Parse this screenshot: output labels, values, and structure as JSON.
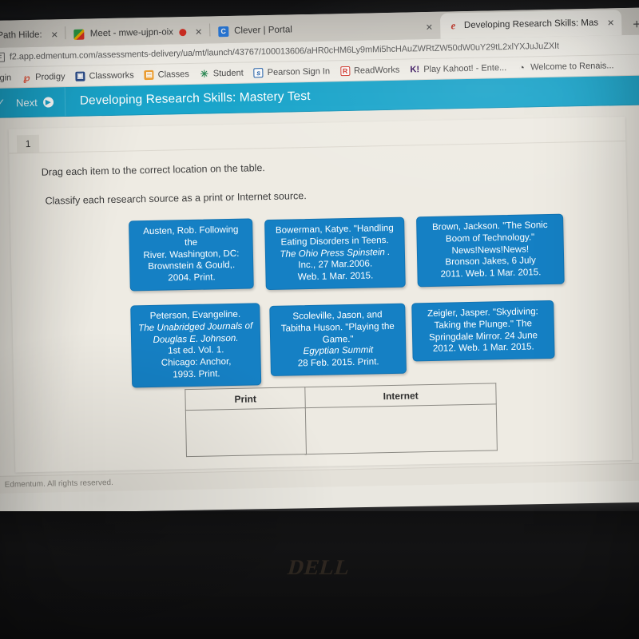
{
  "browser": {
    "tabs": [
      {
        "title": "Path Hilde:",
        "favicon": "none",
        "has_close": true,
        "active": false
      },
      {
        "title": "Meet - mwe-ujpn-oix",
        "favicon": "google-meet-icon",
        "has_close": true,
        "active": false,
        "recording": true
      },
      {
        "title": "Clever | Portal",
        "favicon": "clever-icon",
        "favicon_letter": "C",
        "has_close": true,
        "active": false
      },
      {
        "title": "Developing Research Skills: Mas",
        "favicon": "edge-icon",
        "has_close": true,
        "active": true
      }
    ],
    "new_tab_label": "+",
    "close_glyph": "✕",
    "url": "f2.app.edmentum.com/assessments-delivery/ua/mt/launch/43767/100013606/aHR0cHM6Ly9mMi5hcHAuZWRtZW50dW0uY29tL2xlYXJuJuZXIt",
    "bookmarks": [
      {
        "label": "ogin",
        "icon": "none"
      },
      {
        "label": "Prodigy",
        "icon": "prodigy-icon",
        "glyph": "℘"
      },
      {
        "label": "Classworks",
        "icon": "classworks-icon",
        "glyph": "▣"
      },
      {
        "label": "Classes",
        "icon": "classes-icon",
        "glyph": "▤"
      },
      {
        "label": "Student",
        "icon": "student-icon",
        "glyph": "✳"
      },
      {
        "label": "Pearson Sign In",
        "icon": "pearson-icon",
        "glyph": "s"
      },
      {
        "label": "ReadWorks",
        "icon": "readworks-icon",
        "glyph": "R"
      },
      {
        "label": "Play Kahoot! - Ente...",
        "icon": "kahoot-icon",
        "glyph": "K!"
      },
      {
        "label": "Welcome to Renais...",
        "icon": "renaissance-icon",
        "glyph": "◔"
      }
    ]
  },
  "app_header": {
    "check_glyph": "✓",
    "next_label": "Next",
    "next_arrow_glyph": "▶",
    "title": "Developing Research Skills: Mastery Test",
    "bg_color": "#1aa5cb"
  },
  "question": {
    "number": "1",
    "instruction_1": "Drag each item to the correct location on the table.",
    "instruction_2": "Classify each research source as a print or Internet source."
  },
  "cards": [
    {
      "id": "card-1",
      "name": "source-card-austen",
      "lines": [
        {
          "text": "Austen, Rob. Following the",
          "italic": false
        },
        {
          "text": "River. Washington, DC:",
          "italic": false
        },
        {
          "text": "Brownstein & Gould,.",
          "italic": false
        },
        {
          "text": "2004. Print.",
          "italic": false
        }
      ]
    },
    {
      "id": "card-2",
      "name": "source-card-bowerman",
      "lines": [
        {
          "text": "Bowerman, Katye. \"Handling",
          "italic": false
        },
        {
          "text": "Eating Disorders in Teens.",
          "italic": false
        },
        {
          "text": "The Ohio Press Spinstein .",
          "italic": true
        },
        {
          "text": "Inc., 27 Mar.2006.",
          "italic": false
        },
        {
          "text": "Web. 1 Mar. 2015.",
          "italic": false
        }
      ]
    },
    {
      "id": "card-3",
      "name": "source-card-brown",
      "lines": [
        {
          "text": "Brown, Jackson. \"The Sonic",
          "italic": false
        },
        {
          "text": "Boom of Technology.\"",
          "italic": false
        },
        {
          "text": "News!News!News!",
          "italic": false
        },
        {
          "text": "Bronson Jakes, 6 July",
          "italic": false
        },
        {
          "text": "2011. Web. 1 Mar. 2015.",
          "italic": false
        }
      ]
    },
    {
      "id": "card-4",
      "name": "source-card-peterson",
      "lines": [
        {
          "text": "Peterson, Evangeline. ",
          "italic": false
        },
        {
          "text": "The Unabridged Journals of Douglas E. Johnson.",
          "italic": true
        },
        {
          "text": "1st ed. Vol. 1.",
          "italic": false
        },
        {
          "text": "Chicago: Anchor,",
          "italic": false
        },
        {
          "text": "1993. Print.",
          "italic": false
        }
      ]
    },
    {
      "id": "card-5",
      "name": "source-card-scoleville",
      "lines": [
        {
          "text": "Scoleville, Jason, and",
          "italic": false
        },
        {
          "text": "Tabitha Huson. \"Playing the",
          "italic": false
        },
        {
          "text": "Game.\" ",
          "italic": false
        },
        {
          "text": "Egyptian Summit",
          "italic": true
        },
        {
          "text": "28 Feb. 2015. Print.",
          "italic": false
        }
      ]
    },
    {
      "id": "card-6",
      "name": "source-card-zeigler",
      "lines": [
        {
          "text": "Zeigler, Jasper. \"Skydiving:",
          "italic": false
        },
        {
          "text": "Taking the Plunge.\" The",
          "italic": false
        },
        {
          "text": "Springdale Mirror. 24 June",
          "italic": false
        },
        {
          "text": "2012. Web. 1 Mar. 2015.",
          "italic": false
        }
      ]
    }
  ],
  "drop_table": {
    "columns": [
      "Print",
      "Internet"
    ],
    "rows": [
      [
        "",
        ""
      ]
    ]
  },
  "footer": {
    "copyright": "Edmentum. All rights reserved."
  },
  "hardware": {
    "brand": "DELL"
  },
  "colors": {
    "header_teal": "#1aa5cb",
    "card_blue": "#1580c4",
    "page_bg": "#eeebe3"
  }
}
